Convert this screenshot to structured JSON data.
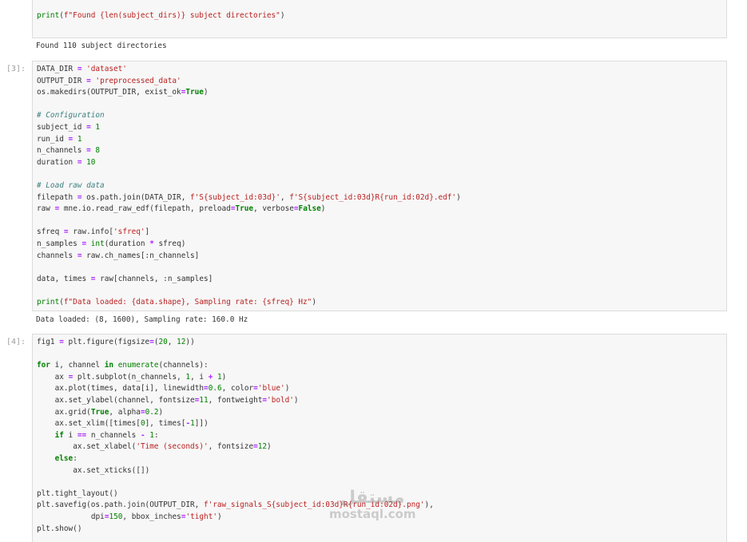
{
  "cells": [
    {
      "prompt": "",
      "lines": [
        "print(f\"Found {len(subject_dirs)} subject directories\")"
      ],
      "output": "Found 110 subject directories"
    },
    {
      "prompt": "[3]:",
      "lines": [
        "DATA_DIR = 'dataset'",
        "OUTPUT_DIR = 'preprocessed_data'",
        "os.makedirs(OUTPUT_DIR, exist_ok=True)",
        "",
        "# Configuration",
        "subject_id = 1",
        "run_id = 1",
        "n_channels = 8",
        "duration = 10",
        "",
        "# Load raw data",
        "filepath = os.path.join(DATA_DIR, f'S{subject_id:03d}', f'S{subject_id:03d}R{run_id:02d}.edf')",
        "raw = mne.io.read_raw_edf(filepath, preload=True, verbose=False)",
        "",
        "sfreq = raw.info['sfreq']",
        "n_samples = int(duration * sfreq)",
        "channels = raw.ch_names[:n_channels]",
        "",
        "data, times = raw[channels, :n_samples]",
        "",
        "print(f\"Data loaded: {data.shape}, Sampling rate: {sfreq} Hz\")"
      ],
      "output": "Data loaded: (8, 1600), Sampling rate: 160.0 Hz"
    },
    {
      "prompt": "[4]:",
      "lines": [
        "fig1 = plt.figure(figsize=(20, 12))",
        "",
        "for i, channel in enumerate(channels):",
        "    ax = plt.subplot(n_channels, 1, i + 1)",
        "    ax.plot(times, data[i], linewidth=0.6, color='blue')",
        "    ax.set_ylabel(channel, fontsize=11, fontweight='bold')",
        "    ax.grid(True, alpha=0.2)",
        "    ax.set_xlim([times[0], times[-1]])",
        "    if i == n_channels - 1:",
        "        ax.set_xlabel('Time (seconds)', fontsize=12)",
        "    else:",
        "        ax.set_xticks([])",
        "",
        "plt.tight_layout()",
        "plt.savefig(os.path.join(OUTPUT_DIR, f'raw_signals_S{subject_id:03d}R{run_id:02d}.png'),",
        "            dpi=150, bbox_inches='tight')",
        "plt.show()"
      ],
      "output": ""
    }
  ],
  "watermark": {
    "logo_text": "مستقل",
    "domain": "mostaql.com"
  }
}
